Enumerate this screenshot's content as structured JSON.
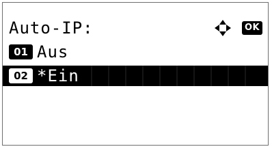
{
  "header": {
    "title": "Auto-IP:",
    "nav_icon": "four-way-arrow-icon",
    "ok_label": "OK"
  },
  "menu": {
    "items": [
      {
        "number": "01",
        "label": "Aus",
        "selected": false
      },
      {
        "number": "02",
        "label": "*Ein",
        "selected": true
      }
    ]
  },
  "colors": {
    "selection_bg": "#000000",
    "text": "#000000",
    "background": "#ffffff"
  }
}
